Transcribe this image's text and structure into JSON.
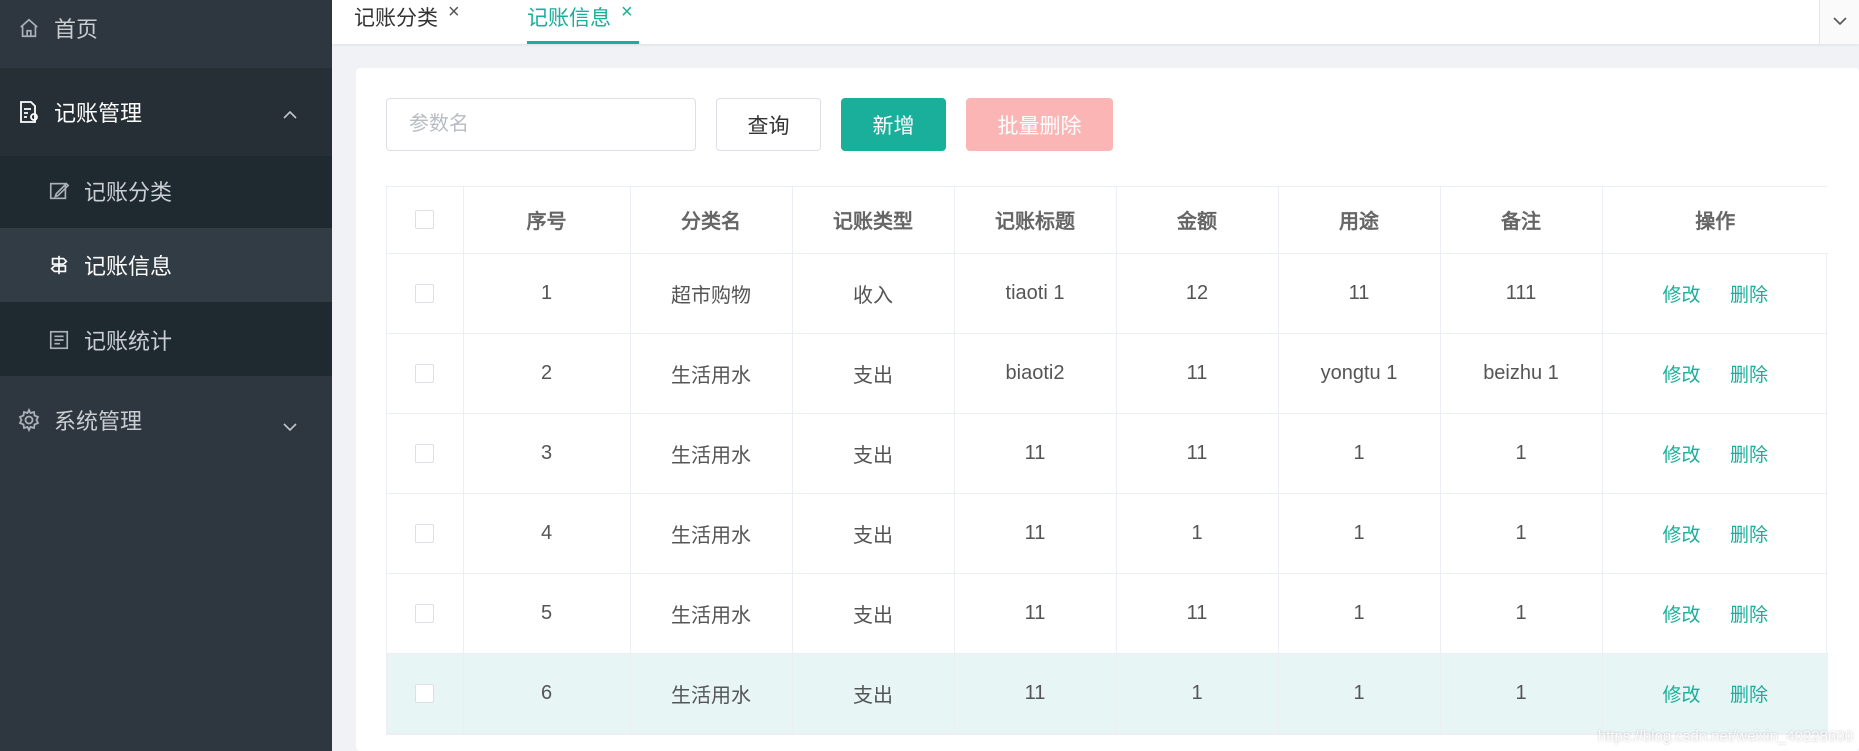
{
  "sidebar": {
    "home_label": "首页",
    "group_label": "记账管理",
    "sub_items": [
      {
        "label": "记账分类"
      },
      {
        "label": "记账信息"
      },
      {
        "label": "记账统计"
      }
    ],
    "system_label": "系统管理"
  },
  "tabs": [
    {
      "label": "记账分类",
      "close": "×"
    },
    {
      "label": "记账信息",
      "close": "×"
    }
  ],
  "toolbar": {
    "search_placeholder": "参数名",
    "query_label": "查询",
    "add_label": "新增",
    "batch_delete_label": "批量删除"
  },
  "table": {
    "headers": [
      "序号",
      "分类名",
      "记账类型",
      "记账标题",
      "金额",
      "用途",
      "备注",
      "操作"
    ],
    "edit_label": "修改",
    "delete_label": "删除",
    "rows": [
      {
        "no": "1",
        "category": "超市购物",
        "type": "收入",
        "title": "tiaoti 1",
        "amount": "12",
        "usage": "11",
        "note": "111"
      },
      {
        "no": "2",
        "category": "生活用水",
        "type": "支出",
        "title": "biaoti2",
        "amount": "11",
        "usage": "yongtu 1",
        "note": "beizhu 1"
      },
      {
        "no": "3",
        "category": "生活用水",
        "type": "支出",
        "title": "11",
        "amount": "11",
        "usage": "1",
        "note": "1"
      },
      {
        "no": "4",
        "category": "生活用水",
        "type": "支出",
        "title": "11",
        "amount": "1",
        "usage": "1",
        "note": "1"
      },
      {
        "no": "5",
        "category": "生活用水",
        "type": "支出",
        "title": "11",
        "amount": "11",
        "usage": "1",
        "note": "1"
      },
      {
        "no": "6",
        "category": "生活用水",
        "type": "支出",
        "title": "11",
        "amount": "1",
        "usage": "1",
        "note": "1"
      }
    ]
  },
  "watermark": "https://blog.csdn.net/weixin_40228600",
  "colors": {
    "accent": "#1aaf9b",
    "danger_light": "#fbb5b5",
    "sidebar_bg": "#2e363f"
  }
}
